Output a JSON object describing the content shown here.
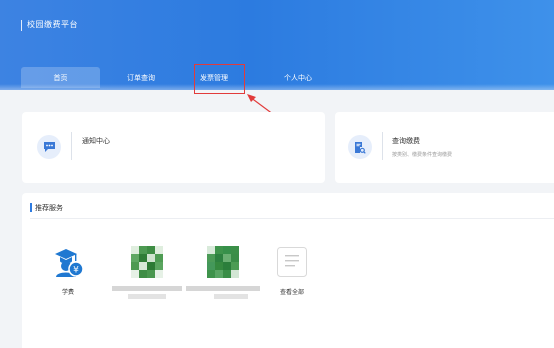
{
  "header": {
    "brand": "校园缴费平台",
    "tabs": [
      {
        "label": "首页",
        "active": true
      },
      {
        "label": "订单查询",
        "active": false
      },
      {
        "label": "发票管理",
        "active": false
      },
      {
        "label": "个人中心",
        "active": false
      }
    ]
  },
  "cards": {
    "notice": {
      "icon": "message-icon",
      "title": "通知中心"
    },
    "query": {
      "icon": "document-search-icon",
      "title": "查询缴费",
      "subtitle": "按类别、缴费条件查询缴费"
    }
  },
  "services": {
    "title": "推荐服务",
    "items": [
      {
        "label": "学费",
        "icon": "tuition-icon"
      },
      {
        "label": "",
        "icon": "blurred-icon"
      },
      {
        "label": "",
        "icon": "blurred-icon"
      },
      {
        "label": "查看全部",
        "icon": "view-all-icon"
      }
    ]
  },
  "colors": {
    "header_blue": "#2c7be0",
    "accent": "#2e7be0",
    "annotation_red": "#e23b3b"
  }
}
